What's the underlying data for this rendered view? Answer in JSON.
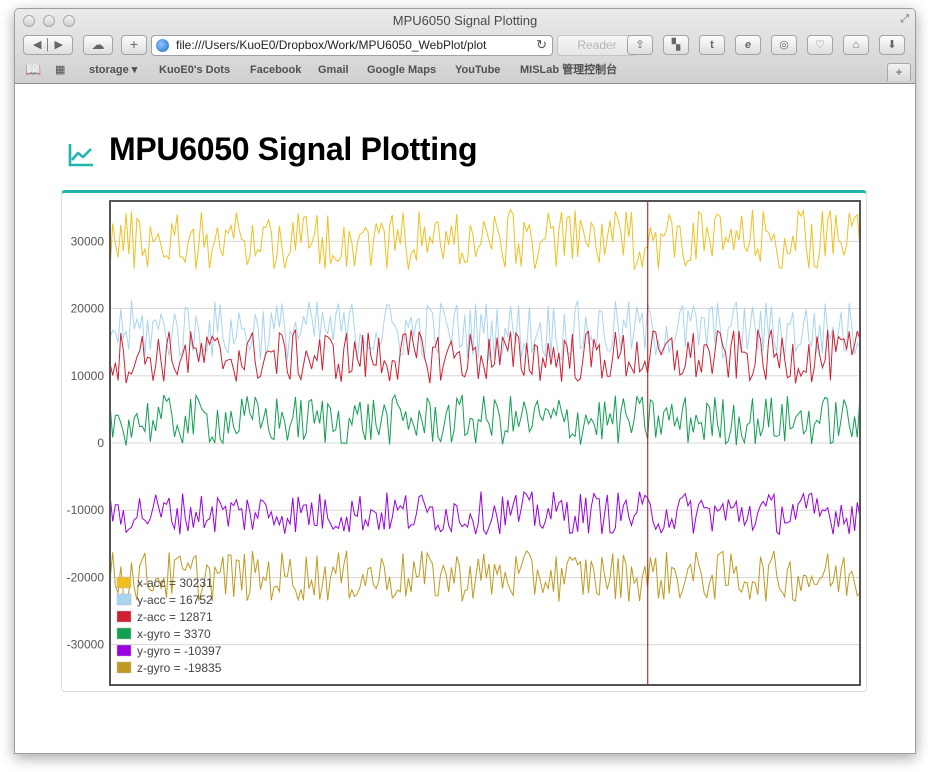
{
  "window": {
    "title": "MPU6050 Signal Plotting"
  },
  "browser": {
    "url": "file:///Users/KuoE0/Dropbox/Work/MPU6050_WebPlot/plot",
    "reader_label": "Reader",
    "bookmarks": [
      {
        "label": "storage ▾"
      },
      {
        "label": "KuoE0's Dots"
      },
      {
        "label": "Facebook"
      },
      {
        "label": "Gmail"
      },
      {
        "label": "Google Maps"
      },
      {
        "label": "YouTube"
      },
      {
        "label": "MISLab 管理控制台"
      }
    ]
  },
  "page": {
    "title": "MPU6050 Signal Plotting"
  },
  "chart_data": {
    "type": "line",
    "ylim": [
      -36000,
      36000
    ],
    "yticks": [
      30000,
      20000,
      10000,
      0,
      -10000,
      -20000,
      -30000
    ],
    "y_tick_labels": [
      "30000",
      "20000",
      "10000",
      "0",
      "-10000",
      "-20000",
      "-30000"
    ],
    "grid": true,
    "legend_position": "bottom-left",
    "cursor_fraction": 0.717,
    "sample_count": 280,
    "series": [
      {
        "name": "x-acc",
        "color": "#f0c020",
        "center": 30231,
        "amplitude": 4500,
        "legend": "x-acc = 30231"
      },
      {
        "name": "y-acc",
        "color": "#a8d4f0",
        "center": 16752,
        "amplitude": 4500,
        "legend": "y-acc = 16752"
      },
      {
        "name": "z-acc",
        "color": "#d02030",
        "center": 12871,
        "amplitude": 4000,
        "legend": "z-acc = 12871"
      },
      {
        "name": "x-gyro",
        "color": "#10a050",
        "center": 3370,
        "amplitude": 3800,
        "legend": "x-gyro = 3370"
      },
      {
        "name": "y-gyro",
        "color": "#9a00e0",
        "center": -10397,
        "amplitude": 3200,
        "legend": "y-gyro = -10397"
      },
      {
        "name": "z-gyro",
        "color": "#c09a20",
        "center": -19835,
        "amplitude": 3800,
        "legend": "z-gyro = -19835"
      }
    ]
  }
}
